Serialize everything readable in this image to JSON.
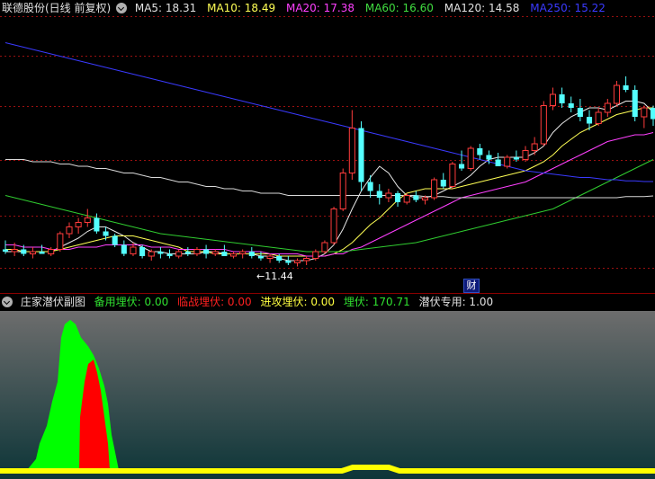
{
  "header": {
    "stock": "联德股份(日线 前复权)",
    "ma": [
      {
        "label": "MA5: 18.31",
        "color": "#e0e0e0"
      },
      {
        "label": "MA10: 18.49",
        "color": "#ffff55"
      },
      {
        "label": "MA20: 17.38",
        "color": "#ff40ff"
      },
      {
        "label": "MA60: 16.60",
        "color": "#40dd40"
      },
      {
        "label": "MA120: 14.58",
        "color": "#e0e0e0"
      },
      {
        "label": "MA250: 15.22",
        "color": "#3a3aff"
      }
    ]
  },
  "low_label": "11.44",
  "finance_badge": "财",
  "sub": {
    "title": "庄家潜伏副图",
    "items": [
      {
        "label": "备用埋伏: 0.00",
        "color": "#30e030"
      },
      {
        "label": "临战埋伏: 0.00",
        "color": "#ff2020"
      },
      {
        "label": "进攻埋伏: 0.00",
        "color": "#ffff40"
      },
      {
        "label": "埋伏: 170.71",
        "color": "#30e030"
      },
      {
        "label": "潜伏专用: 1.00",
        "color": "#e0e0e0"
      }
    ]
  },
  "colors": {
    "up": "#ff3c3c",
    "down": "#54ffff",
    "grid": "#9a1010",
    "sub_green": "#00ff00",
    "sub_red": "#ff0000",
    "sub_yellow": "#ffff00"
  },
  "chart_data": {
    "type": "candlestick",
    "candles": [
      {
        "o": 12.2,
        "h": 12.6,
        "l": 12.0,
        "c": 12.1
      },
      {
        "o": 12.1,
        "h": 12.5,
        "l": 11.9,
        "c": 12.2
      },
      {
        "o": 12.2,
        "h": 12.4,
        "l": 11.9,
        "c": 12.0
      },
      {
        "o": 12.0,
        "h": 12.3,
        "l": 11.8,
        "c": 12.1
      },
      {
        "o": 12.1,
        "h": 12.4,
        "l": 12.0,
        "c": 12.0
      },
      {
        "o": 12.0,
        "h": 12.3,
        "l": 11.9,
        "c": 12.2
      },
      {
        "o": 12.2,
        "h": 13.0,
        "l": 12.1,
        "c": 12.9
      },
      {
        "o": 12.9,
        "h": 13.4,
        "l": 12.7,
        "c": 13.2
      },
      {
        "o": 13.2,
        "h": 13.6,
        "l": 12.9,
        "c": 13.4
      },
      {
        "o": 13.4,
        "h": 14.0,
        "l": 13.2,
        "c": 13.6
      },
      {
        "o": 13.6,
        "h": 13.8,
        "l": 12.9,
        "c": 13.0
      },
      {
        "o": 13.0,
        "h": 13.2,
        "l": 12.6,
        "c": 12.8
      },
      {
        "o": 12.8,
        "h": 12.9,
        "l": 12.3,
        "c": 12.4
      },
      {
        "o": 12.4,
        "h": 12.6,
        "l": 11.9,
        "c": 12.0
      },
      {
        "o": 12.0,
        "h": 12.5,
        "l": 11.9,
        "c": 12.3
      },
      {
        "o": 12.3,
        "h": 12.4,
        "l": 11.8,
        "c": 11.9
      },
      {
        "o": 11.9,
        "h": 12.2,
        "l": 11.7,
        "c": 12.1
      },
      {
        "o": 12.1,
        "h": 12.3,
        "l": 11.8,
        "c": 12.0
      },
      {
        "o": 12.0,
        "h": 12.2,
        "l": 11.8,
        "c": 11.9
      },
      {
        "o": 11.9,
        "h": 12.2,
        "l": 11.8,
        "c": 12.1
      },
      {
        "o": 12.1,
        "h": 12.3,
        "l": 11.9,
        "c": 12.0
      },
      {
        "o": 12.0,
        "h": 12.3,
        "l": 11.9,
        "c": 12.2
      },
      {
        "o": 12.2,
        "h": 12.4,
        "l": 11.8,
        "c": 12.0
      },
      {
        "o": 12.0,
        "h": 12.2,
        "l": 11.9,
        "c": 12.1
      },
      {
        "o": 12.1,
        "h": 12.4,
        "l": 11.9,
        "c": 11.9
      },
      {
        "o": 11.9,
        "h": 12.1,
        "l": 11.8,
        "c": 12.0
      },
      {
        "o": 12.0,
        "h": 12.2,
        "l": 11.8,
        "c": 12.1
      },
      {
        "o": 12.1,
        "h": 12.3,
        "l": 11.8,
        "c": 11.9
      },
      {
        "o": 11.9,
        "h": 12.1,
        "l": 11.7,
        "c": 11.8
      },
      {
        "o": 11.8,
        "h": 12.0,
        "l": 11.6,
        "c": 11.9
      },
      {
        "o": 11.9,
        "h": 12.0,
        "l": 11.6,
        "c": 11.7
      },
      {
        "o": 11.7,
        "h": 11.9,
        "l": 11.5,
        "c": 11.6
      },
      {
        "o": 11.6,
        "h": 11.8,
        "l": 11.44,
        "c": 11.7
      },
      {
        "o": 11.7,
        "h": 11.9,
        "l": 11.5,
        "c": 11.8
      },
      {
        "o": 11.8,
        "h": 12.2,
        "l": 11.7,
        "c": 12.1
      },
      {
        "o": 12.1,
        "h": 12.6,
        "l": 12.0,
        "c": 12.5
      },
      {
        "o": 12.5,
        "h": 14.1,
        "l": 12.4,
        "c": 14.0
      },
      {
        "o": 14.0,
        "h": 15.8,
        "l": 13.9,
        "c": 15.6
      },
      {
        "o": 15.6,
        "h": 18.4,
        "l": 15.3,
        "c": 17.6
      },
      {
        "o": 17.6,
        "h": 17.9,
        "l": 14.8,
        "c": 15.2
      },
      {
        "o": 15.2,
        "h": 15.5,
        "l": 14.5,
        "c": 14.8
      },
      {
        "o": 14.8,
        "h": 15.1,
        "l": 14.2,
        "c": 14.5
      },
      {
        "o": 14.5,
        "h": 14.9,
        "l": 14.3,
        "c": 14.7
      },
      {
        "o": 14.7,
        "h": 14.8,
        "l": 14.1,
        "c": 14.3
      },
      {
        "o": 14.3,
        "h": 14.7,
        "l": 14.2,
        "c": 14.6
      },
      {
        "o": 14.6,
        "h": 14.8,
        "l": 14.3,
        "c": 14.4
      },
      {
        "o": 14.4,
        "h": 14.6,
        "l": 14.2,
        "c": 14.5
      },
      {
        "o": 14.5,
        "h": 15.4,
        "l": 14.4,
        "c": 15.3
      },
      {
        "o": 15.3,
        "h": 15.6,
        "l": 14.9,
        "c": 15.0
      },
      {
        "o": 15.0,
        "h": 16.1,
        "l": 14.9,
        "c": 16.0
      },
      {
        "o": 16.0,
        "h": 16.6,
        "l": 15.7,
        "c": 15.8
      },
      {
        "o": 15.8,
        "h": 16.8,
        "l": 15.7,
        "c": 16.7
      },
      {
        "o": 16.7,
        "h": 16.9,
        "l": 16.2,
        "c": 16.4
      },
      {
        "o": 16.4,
        "h": 16.6,
        "l": 16.0,
        "c": 16.2
      },
      {
        "o": 16.2,
        "h": 16.5,
        "l": 15.9,
        "c": 15.9
      },
      {
        "o": 15.9,
        "h": 16.4,
        "l": 15.8,
        "c": 16.3
      },
      {
        "o": 16.3,
        "h": 16.6,
        "l": 16.1,
        "c": 16.2
      },
      {
        "o": 16.2,
        "h": 16.8,
        "l": 16.1,
        "c": 16.6
      },
      {
        "o": 16.6,
        "h": 17.2,
        "l": 16.4,
        "c": 16.9
      },
      {
        "o": 16.9,
        "h": 18.8,
        "l": 16.8,
        "c": 18.6
      },
      {
        "o": 18.6,
        "h": 19.4,
        "l": 18.4,
        "c": 19.1
      },
      {
        "o": 19.1,
        "h": 19.4,
        "l": 18.5,
        "c": 18.7
      },
      {
        "o": 18.7,
        "h": 19.0,
        "l": 18.3,
        "c": 18.5
      },
      {
        "o": 18.5,
        "h": 18.9,
        "l": 17.9,
        "c": 18.1
      },
      {
        "o": 18.1,
        "h": 18.4,
        "l": 17.5,
        "c": 17.8
      },
      {
        "o": 17.8,
        "h": 18.5,
        "l": 17.7,
        "c": 18.3
      },
      {
        "o": 18.3,
        "h": 18.9,
        "l": 18.1,
        "c": 18.7
      },
      {
        "o": 18.7,
        "h": 19.7,
        "l": 18.6,
        "c": 19.5
      },
      {
        "o": 19.5,
        "h": 19.9,
        "l": 19.2,
        "c": 19.3
      },
      {
        "o": 19.3,
        "h": 19.5,
        "l": 17.9,
        "c": 18.1
      },
      {
        "o": 18.1,
        "h": 18.6,
        "l": 17.6,
        "c": 18.5
      },
      {
        "o": 18.5,
        "h": 18.6,
        "l": 17.7,
        "c": 18.0
      }
    ],
    "ma": {
      "MA5": [
        12.1,
        12.1,
        12.1,
        12.1,
        12.1,
        12.1,
        12.3,
        12.5,
        12.7,
        13.0,
        13.2,
        13.2,
        13.0,
        12.8,
        12.5,
        12.3,
        12.1,
        12.1,
        12.0,
        12.0,
        12.0,
        12.0,
        12.1,
        12.1,
        12.0,
        12.0,
        12.0,
        12.0,
        11.9,
        11.9,
        11.8,
        11.7,
        11.7,
        11.7,
        11.8,
        12.0,
        12.4,
        13.1,
        14.0,
        14.8,
        15.4,
        15.9,
        15.6,
        15.0,
        14.6,
        14.5,
        14.5,
        14.6,
        14.8,
        15.0,
        15.2,
        15.5,
        15.9,
        16.2,
        16.3,
        16.3,
        16.3,
        16.3,
        16.5,
        16.8,
        17.4,
        17.8,
        18.1,
        18.3,
        18.5,
        18.5,
        18.4,
        18.6,
        18.8,
        18.8,
        18.7,
        18.3
      ],
      "MA10": [
        12.2,
        12.2,
        12.1,
        12.1,
        12.1,
        12.1,
        12.2,
        12.3,
        12.4,
        12.5,
        12.6,
        12.7,
        12.8,
        12.8,
        12.8,
        12.7,
        12.6,
        12.5,
        12.4,
        12.3,
        12.1,
        12.1,
        12.1,
        12.0,
        12.0,
        12.0,
        12.0,
        12.0,
        12.0,
        12.0,
        11.9,
        11.9,
        11.9,
        11.9,
        11.9,
        11.9,
        12.0,
        12.2,
        12.5,
        12.9,
        13.3,
        13.6,
        14.0,
        14.4,
        14.7,
        14.8,
        14.9,
        14.9,
        14.9,
        14.9,
        15.0,
        15.1,
        15.2,
        15.3,
        15.4,
        15.5,
        15.6,
        15.7,
        15.9,
        16.1,
        16.4,
        16.8,
        17.1,
        17.4,
        17.6,
        17.8,
        18.0,
        18.2,
        18.3,
        18.4,
        18.5,
        18.5
      ],
      "MA20": [
        12.4,
        12.4,
        12.3,
        12.3,
        12.3,
        12.2,
        12.2,
        12.2,
        12.3,
        12.3,
        12.3,
        12.4,
        12.4,
        12.4,
        12.4,
        12.4,
        12.3,
        12.3,
        12.3,
        12.2,
        12.2,
        12.2,
        12.2,
        12.2,
        12.2,
        12.1,
        12.1,
        12.1,
        12.1,
        12.0,
        12.0,
        12.0,
        12.0,
        11.9,
        11.9,
        11.9,
        12.0,
        12.0,
        12.2,
        12.3,
        12.5,
        12.7,
        12.9,
        13.1,
        13.3,
        13.5,
        13.7,
        13.9,
        14.1,
        14.3,
        14.5,
        14.6,
        14.7,
        14.8,
        14.9,
        15.0,
        15.1,
        15.2,
        15.4,
        15.6,
        15.8,
        16.0,
        16.2,
        16.4,
        16.6,
        16.8,
        17.0,
        17.1,
        17.2,
        17.3,
        17.3,
        17.4
      ],
      "MA60": [
        14.6,
        14.5,
        14.4,
        14.3,
        14.2,
        14.1,
        14.0,
        13.9,
        13.8,
        13.7,
        13.6,
        13.5,
        13.4,
        13.3,
        13.2,
        13.1,
        13.0,
        12.9,
        12.85,
        12.8,
        12.75,
        12.7,
        12.65,
        12.6,
        12.55,
        12.5,
        12.45,
        12.4,
        12.35,
        12.3,
        12.25,
        12.2,
        12.15,
        12.1,
        12.1,
        12.1,
        12.1,
        12.1,
        12.15,
        12.2,
        12.25,
        12.3,
        12.35,
        12.4,
        12.45,
        12.5,
        12.6,
        12.7,
        12.8,
        12.9,
        13.0,
        13.1,
        13.2,
        13.3,
        13.4,
        13.5,
        13.6,
        13.7,
        13.8,
        13.9,
        14.0,
        14.2,
        14.4,
        14.6,
        14.8,
        15.0,
        15.2,
        15.4,
        15.6,
        15.8,
        16.0,
        16.2
      ],
      "MA120": [
        16.2,
        16.2,
        16.2,
        16.1,
        16.1,
        16.1,
        16.0,
        16.0,
        15.9,
        15.9,
        15.8,
        15.8,
        15.7,
        15.6,
        15.6,
        15.5,
        15.4,
        15.4,
        15.3,
        15.2,
        15.2,
        15.1,
        15.0,
        15.0,
        14.9,
        14.9,
        14.8,
        14.8,
        14.7,
        14.7,
        14.7,
        14.6,
        14.6,
        14.6,
        14.6,
        14.6,
        14.6,
        14.6,
        14.6,
        14.6,
        14.6,
        14.6,
        14.6,
        14.6,
        14.6,
        14.6,
        14.55,
        14.55,
        14.55,
        14.5,
        14.5,
        14.5,
        14.5,
        14.5,
        14.5,
        14.5,
        14.5,
        14.5,
        14.5,
        14.5,
        14.5,
        14.5,
        14.5,
        14.5,
        14.5,
        14.5,
        14.5,
        14.5,
        14.55,
        14.55,
        14.55,
        14.58
      ],
      "MA250": [
        21.4,
        21.3,
        21.2,
        21.1,
        21.0,
        20.9,
        20.8,
        20.7,
        20.6,
        20.5,
        20.4,
        20.3,
        20.2,
        20.1,
        20.0,
        19.9,
        19.8,
        19.7,
        19.6,
        19.5,
        19.4,
        19.3,
        19.2,
        19.1,
        19.0,
        18.9,
        18.8,
        18.7,
        18.6,
        18.5,
        18.4,
        18.3,
        18.2,
        18.1,
        18.0,
        17.9,
        17.8,
        17.7,
        17.6,
        17.5,
        17.4,
        17.3,
        17.2,
        17.1,
        17.0,
        16.9,
        16.8,
        16.7,
        16.6,
        16.5,
        16.4,
        16.3,
        16.2,
        16.1,
        16.0,
        15.9,
        15.8,
        15.7,
        15.65,
        15.6,
        15.55,
        15.5,
        15.45,
        15.4,
        15.4,
        15.35,
        15.3,
        15.3,
        15.25,
        15.25,
        15.22,
        15.22
      ]
    },
    "sub_series": {
      "green": [
        0,
        0,
        0,
        0,
        0,
        0,
        0,
        5,
        15,
        35,
        70,
        130,
        160,
        175,
        178,
        170,
        160,
        120,
        60,
        15,
        0,
        0,
        0,
        0,
        0,
        0,
        0,
        0,
        0,
        0,
        0,
        0,
        0,
        0,
        0,
        0,
        0,
        0,
        0,
        0,
        0,
        0,
        0,
        0,
        0,
        0,
        0,
        0,
        0,
        0,
        0,
        0,
        0,
        0,
        0,
        0,
        0,
        0,
        0,
        0,
        0,
        0,
        0,
        0,
        0,
        0,
        0,
        0,
        0,
        0,
        0,
        0
      ],
      "red": [
        0,
        0,
        0,
        0,
        0,
        0,
        0,
        0,
        0,
        0,
        0,
        0,
        0,
        0,
        0,
        0,
        0,
        0,
        0,
        0,
        0,
        0,
        0,
        0,
        0,
        0,
        0,
        0,
        0,
        0,
        0,
        0,
        0,
        0,
        0,
        0,
        0,
        0,
        0,
        0,
        0,
        0,
        0,
        0,
        0,
        0,
        0,
        0,
        0,
        0,
        0,
        0,
        0,
        0,
        0,
        0,
        0,
        0,
        0,
        0,
        0,
        0,
        0,
        0,
        0,
        0,
        0,
        0,
        0,
        0,
        0,
        0
      ],
      "yellow_bump": [
        0,
        0,
        0,
        0,
        0,
        0,
        0,
        0,
        0,
        0,
        0,
        0,
        0,
        0,
        0,
        0,
        0,
        0,
        0,
        0,
        0,
        0,
        0,
        0,
        0,
        0,
        0,
        0,
        0,
        0,
        0,
        0,
        0,
        0,
        0,
        0,
        0,
        0,
        0,
        0,
        1,
        1,
        1,
        0,
        0,
        0,
        0,
        0,
        0,
        0,
        0,
        0,
        0,
        0,
        0,
        0,
        0,
        0,
        0,
        0,
        0,
        0,
        0,
        0,
        0,
        0,
        0,
        0,
        0,
        0,
        0,
        0
      ]
    },
    "sub_red_profile": [
      0,
      0,
      0,
      0,
      0,
      0,
      0,
      0,
      0,
      0,
      0,
      0,
      0,
      0,
      0,
      0,
      0,
      0,
      0,
      0,
      0,
      0,
      0,
      0,
      0,
      0,
      0,
      0,
      0,
      0,
      0,
      0,
      0,
      0,
      0,
      0,
      0,
      0,
      0,
      0,
      0,
      0,
      0,
      0,
      0,
      0,
      0,
      0,
      0,
      0,
      0,
      0,
      0,
      0,
      0,
      0,
      0,
      0,
      0,
      0,
      0,
      0,
      0,
      0,
      0,
      0,
      0,
      0,
      0,
      0,
      0,
      0
    ]
  }
}
